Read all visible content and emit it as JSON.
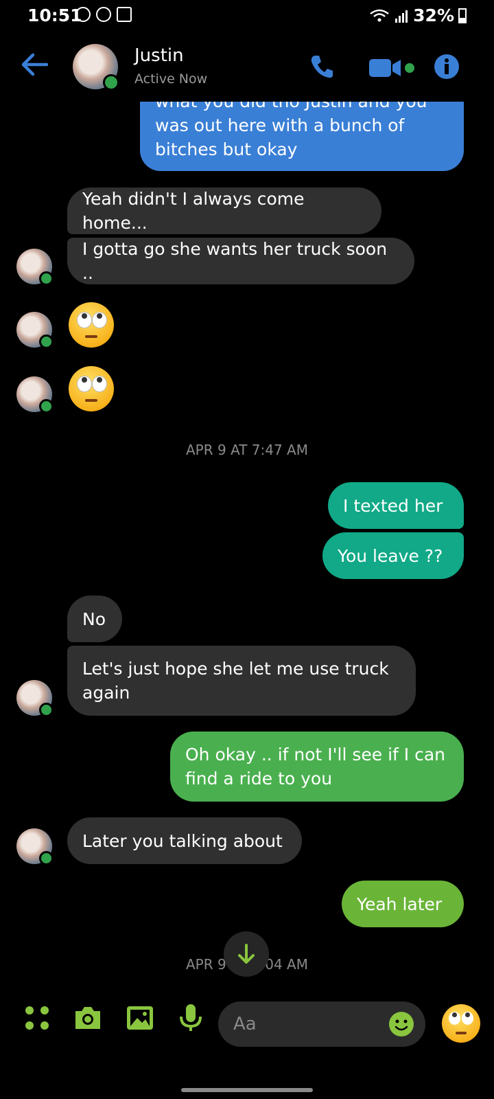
{
  "status_bar": {
    "time": "10:51",
    "battery": "32%"
  },
  "header": {
    "name": "Justin",
    "status": "Active Now"
  },
  "messages": {
    "m1": {
      "lines": [
        "what you did tho Justin and you",
        "was out here with a bunch of",
        "bitches but okay"
      ]
    },
    "m2": "Yeah didn't I always come home...",
    "m3": "I gotta go she wants her truck soon ..",
    "ts1": "APR 9 AT 7:47 AM",
    "m4": "I texted her",
    "m5": "You leave ??",
    "m6": "No",
    "m7": {
      "lines": [
        "Let's just hope she let me use truck",
        "again"
      ]
    },
    "m8": {
      "lines": [
        "Oh okay .. if not I'll see if I can",
        "find a ride to you"
      ]
    },
    "m9": "Later you talking about",
    "m10": "Yeah later",
    "ts2": "APR 9 AT 8:04 AM"
  },
  "composer": {
    "placeholder": "Aa"
  },
  "colors": {
    "accent_blue": "#3a7fd6",
    "accent_green": "#8ac53f",
    "online": "#31a24c",
    "incoming_bg": "#303030"
  }
}
